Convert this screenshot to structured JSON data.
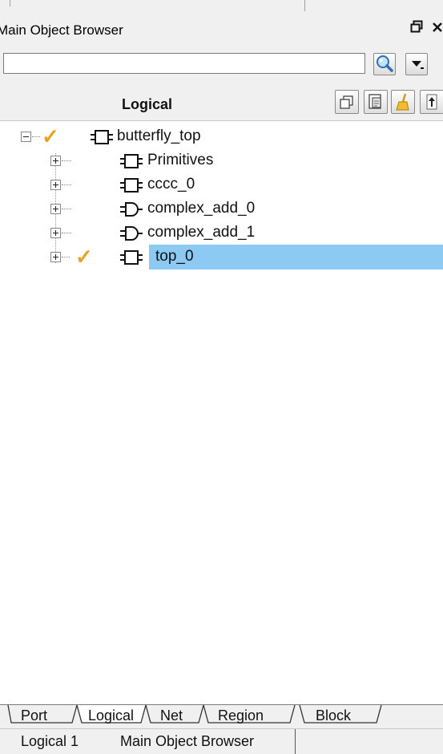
{
  "window": {
    "title": "Main Object Browser",
    "restore_glyph": "Έ",
    "close_glyph": "×"
  },
  "search": {
    "value": "",
    "placeholder": ""
  },
  "panel": {
    "title": "Logical"
  },
  "tree": {
    "root": {
      "label": "butterfly_top",
      "expanded": true,
      "checked": true,
      "icon": "cell-icon"
    },
    "children": [
      {
        "label": "Primitives",
        "icon": "cell-icon",
        "checked": false
      },
      {
        "label": "cccc_0",
        "icon": "cell-icon",
        "checked": false
      },
      {
        "label": "complex_add_0",
        "icon": "and-gate-icon",
        "checked": false
      },
      {
        "label": "complex_add_1",
        "icon": "and-gate-icon",
        "checked": false
      },
      {
        "label": "top_0",
        "icon": "cell-icon",
        "checked": true,
        "selected": true
      }
    ]
  },
  "tabs": [
    "Port",
    "Logical",
    "Net",
    "Region",
    "Block"
  ],
  "active_tab": "Logical",
  "bottom_tabs": [
    "Logical 1",
    "Main Object Browser"
  ],
  "active_bottom_tab": "Main Object Browser",
  "colors": {
    "selection": "#8ccaf4",
    "check": "#eaa21c",
    "background": "#f0f0f0"
  }
}
